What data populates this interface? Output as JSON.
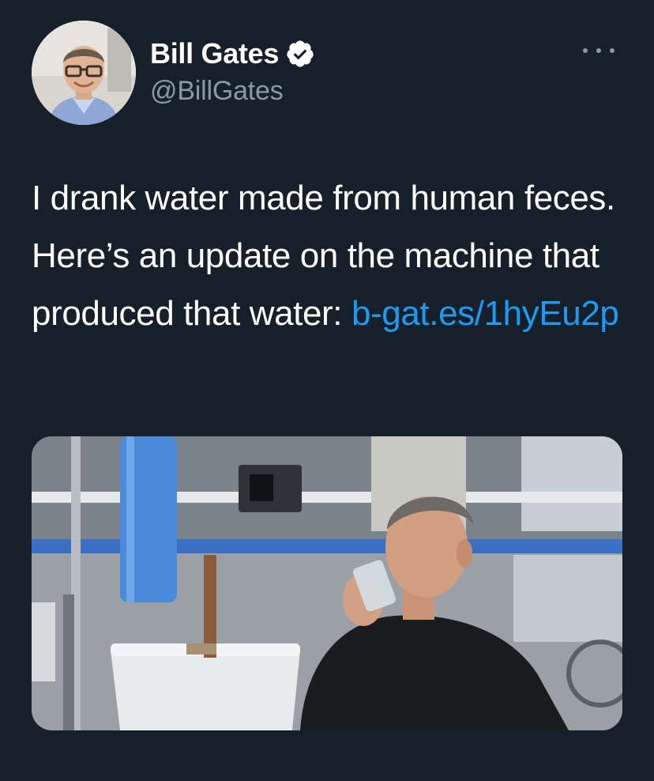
{
  "author": {
    "display_name": "Bill Gates",
    "handle": "@BillGates",
    "verified": true,
    "avatar_icon": "profile-photo"
  },
  "tweet": {
    "text_before_link": "I drank water made from human feces. Here’s an update on the machine that produced that water: ",
    "link_text": "b-gat.es/1hyEu2p"
  },
  "media": {
    "icon": "photo"
  },
  "colors": {
    "background": "#15202b",
    "link": "#1d9bf0",
    "secondary_text": "#8b98a5",
    "verified_badge": "#ffffff"
  }
}
